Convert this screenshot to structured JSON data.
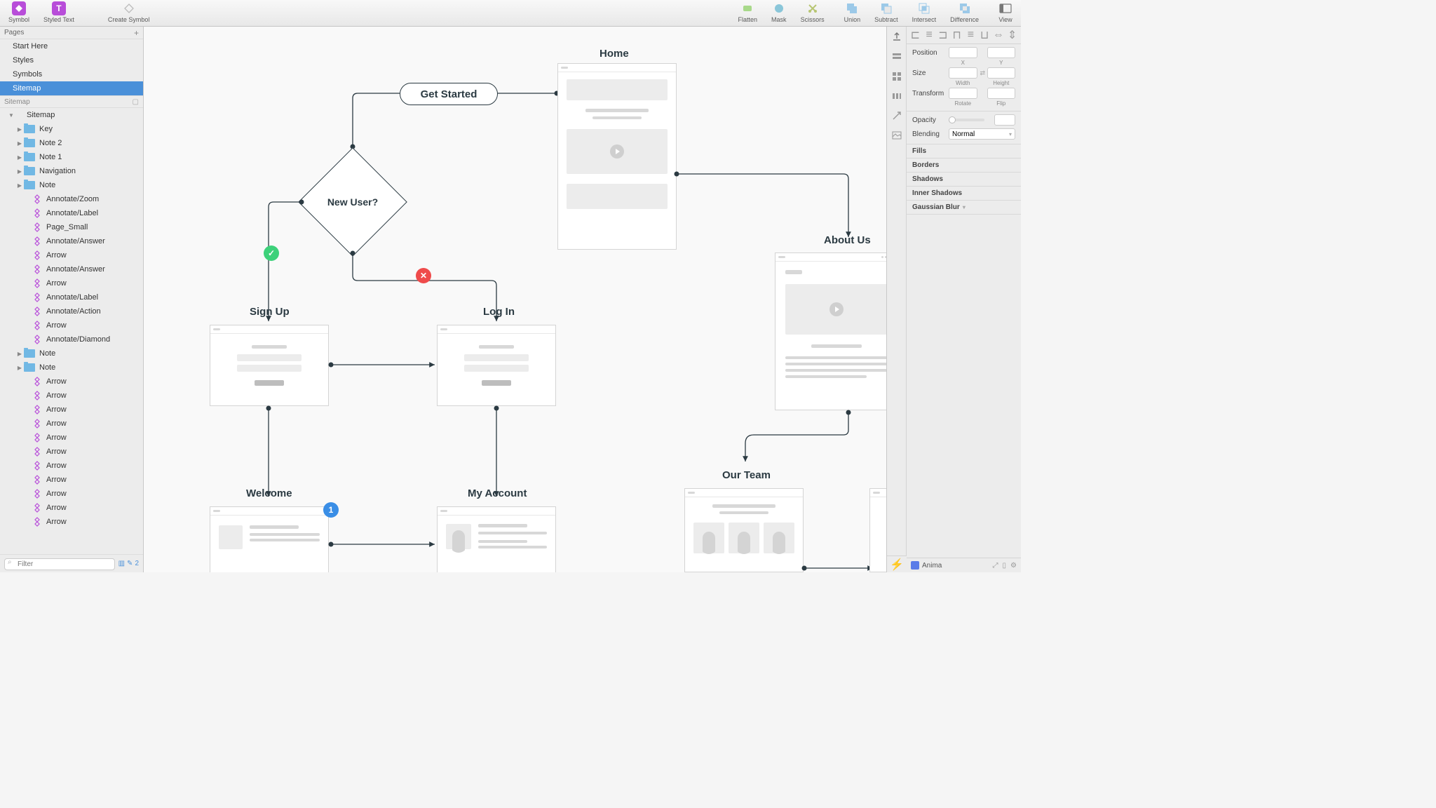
{
  "toolbar": {
    "left": [
      {
        "label": "Symbol",
        "color": "#b84dd9"
      },
      {
        "label": "Styled Text",
        "color": "#b84dd9"
      }
    ],
    "create_symbol": "Create Symbol",
    "shape_ops": [
      {
        "label": "Flatten"
      },
      {
        "label": "Mask"
      },
      {
        "label": "Scissors"
      }
    ],
    "boolean_ops": [
      {
        "label": "Union"
      },
      {
        "label": "Subtract"
      },
      {
        "label": "Intersect"
      },
      {
        "label": "Difference"
      }
    ],
    "view": "View"
  },
  "pages": {
    "header": "Pages",
    "items": [
      "Start Here",
      "Styles",
      "Symbols",
      "Sitemap"
    ],
    "active_index": 3
  },
  "section_name": "Sitemap",
  "layers": [
    {
      "name": "Sitemap",
      "type": "artboard",
      "depth": 0,
      "expanded": true
    },
    {
      "name": "Key",
      "type": "folder",
      "depth": 1,
      "collapsed": true
    },
    {
      "name": "Note 2",
      "type": "folder",
      "depth": 1,
      "collapsed": true
    },
    {
      "name": "Note 1",
      "type": "folder",
      "depth": 1,
      "collapsed": true
    },
    {
      "name": "Navigation",
      "type": "folder",
      "depth": 1,
      "collapsed": true
    },
    {
      "name": "Note",
      "type": "folder",
      "depth": 1,
      "collapsed": true
    },
    {
      "name": "Annotate/Zoom",
      "type": "symbol",
      "depth": 2
    },
    {
      "name": "Annotate/Label",
      "type": "symbol",
      "depth": 2
    },
    {
      "name": "Page_Small",
      "type": "symbol",
      "depth": 2
    },
    {
      "name": "Annotate/Answer",
      "type": "symbol",
      "depth": 2
    },
    {
      "name": "Arrow",
      "type": "symbol",
      "depth": 2
    },
    {
      "name": "Annotate/Answer",
      "type": "symbol",
      "depth": 2
    },
    {
      "name": "Arrow",
      "type": "symbol",
      "depth": 2
    },
    {
      "name": "Annotate/Label",
      "type": "symbol",
      "depth": 2
    },
    {
      "name": "Annotate/Action",
      "type": "symbol",
      "depth": 2
    },
    {
      "name": "Arrow",
      "type": "symbol",
      "depth": 2
    },
    {
      "name": "Annotate/Diamond",
      "type": "symbol",
      "depth": 2
    },
    {
      "name": "Note",
      "type": "folder",
      "depth": 1,
      "collapsed": true
    },
    {
      "name": "Note",
      "type": "folder",
      "depth": 1,
      "collapsed": true
    },
    {
      "name": "Arrow",
      "type": "symbol",
      "depth": 2
    },
    {
      "name": "Arrow",
      "type": "symbol",
      "depth": 2
    },
    {
      "name": "Arrow",
      "type": "symbol",
      "depth": 2
    },
    {
      "name": "Arrow",
      "type": "symbol",
      "depth": 2
    },
    {
      "name": "Arrow",
      "type": "symbol",
      "depth": 2
    },
    {
      "name": "Arrow",
      "type": "symbol",
      "depth": 2
    },
    {
      "name": "Arrow",
      "type": "symbol",
      "depth": 2
    },
    {
      "name": "Arrow",
      "type": "symbol",
      "depth": 2
    },
    {
      "name": "Arrow",
      "type": "symbol",
      "depth": 2
    },
    {
      "name": "Arrow",
      "type": "symbol",
      "depth": 2
    },
    {
      "name": "Arrow",
      "type": "symbol",
      "depth": 2
    }
  ],
  "filter_placeholder": "Filter",
  "filter_count": "2",
  "canvas": {
    "get_started": "Get Started",
    "new_user": "New User?",
    "home": "Home",
    "sign_up": "Sign Up",
    "log_in": "Log In",
    "about_us": "About Us",
    "welcome": "Welcome",
    "my_account": "My Account",
    "our_team": "Our Team",
    "badge_one": "1",
    "badge_check": "✓",
    "badge_x": "✕"
  },
  "inspector": {
    "position": "Position",
    "x": "X",
    "y": "Y",
    "size": "Size",
    "width": "Width",
    "height": "Height",
    "transform": "Transform",
    "rotate": "Rotate",
    "flip": "Flip",
    "opacity": "Opacity",
    "blending": "Blending",
    "blend_mode": "Normal",
    "fills": "Fills",
    "borders": "Borders",
    "shadows": "Shadows",
    "inner_shadows": "Inner Shadows",
    "gaussian_blur": "Gaussian Blur"
  },
  "plugin": "Anima"
}
